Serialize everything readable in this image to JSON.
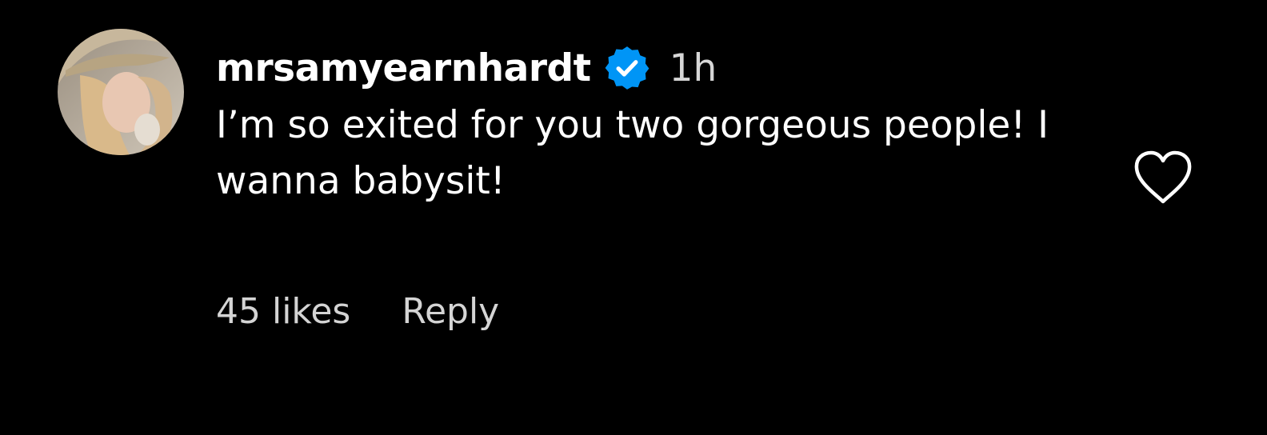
{
  "comment": {
    "username": "mrsamyearnhardt",
    "verified": true,
    "time": "1h",
    "text": "I’m so exited for you two gorgeous people! I wanna babysit!",
    "likes_text": "45 likes",
    "reply_label": "Reply"
  },
  "icons": {
    "avatar": "profile-photo",
    "verified": "verified-badge-icon",
    "like": "heart-outline-icon"
  },
  "colors": {
    "background": "#000000",
    "text": "#ffffff",
    "secondary_text": "#d4d4d4",
    "verified_badge": "#0095f6"
  }
}
